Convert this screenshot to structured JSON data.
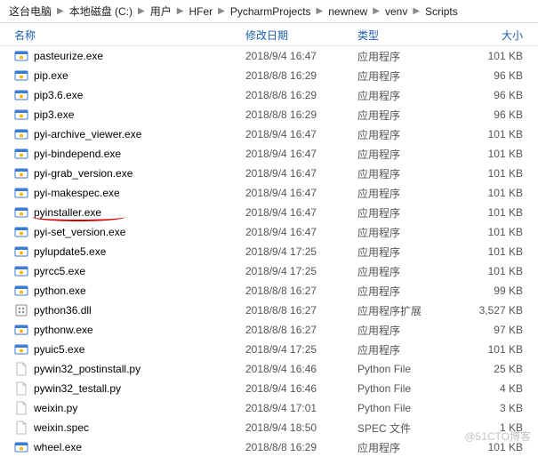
{
  "breadcrumb": {
    "items": [
      "这台电脑",
      "本地磁盘 (C:)",
      "用户",
      "HFer",
      "PycharmProjects",
      "newnew",
      "venv",
      "Scripts"
    ]
  },
  "columns": {
    "name": "名称",
    "date": "修改日期",
    "type": "类型",
    "size": "大小"
  },
  "files": [
    {
      "icon": "exe",
      "name": "pasteurize.exe",
      "date": "2018/9/4 16:47",
      "type": "应用程序",
      "size": "101 KB"
    },
    {
      "icon": "exe",
      "name": "pip.exe",
      "date": "2018/8/8 16:29",
      "type": "应用程序",
      "size": "96 KB"
    },
    {
      "icon": "exe",
      "name": "pip3.6.exe",
      "date": "2018/8/8 16:29",
      "type": "应用程序",
      "size": "96 KB"
    },
    {
      "icon": "exe",
      "name": "pip3.exe",
      "date": "2018/8/8 16:29",
      "type": "应用程序",
      "size": "96 KB"
    },
    {
      "icon": "exe",
      "name": "pyi-archive_viewer.exe",
      "date": "2018/9/4 16:47",
      "type": "应用程序",
      "size": "101 KB"
    },
    {
      "icon": "exe",
      "name": "pyi-bindepend.exe",
      "date": "2018/9/4 16:47",
      "type": "应用程序",
      "size": "101 KB"
    },
    {
      "icon": "exe",
      "name": "pyi-grab_version.exe",
      "date": "2018/9/4 16:47",
      "type": "应用程序",
      "size": "101 KB"
    },
    {
      "icon": "exe",
      "name": "pyi-makespec.exe",
      "date": "2018/9/4 16:47",
      "type": "应用程序",
      "size": "101 KB"
    },
    {
      "icon": "exe",
      "name": "pyinstaller.exe",
      "date": "2018/9/4 16:47",
      "type": "应用程序",
      "size": "101 KB",
      "highlight": true
    },
    {
      "icon": "exe",
      "name": "pyi-set_version.exe",
      "date": "2018/9/4 16:47",
      "type": "应用程序",
      "size": "101 KB"
    },
    {
      "icon": "exe",
      "name": "pylupdate5.exe",
      "date": "2018/9/4 17:25",
      "type": "应用程序",
      "size": "101 KB"
    },
    {
      "icon": "exe",
      "name": "pyrcc5.exe",
      "date": "2018/9/4 17:25",
      "type": "应用程序",
      "size": "101 KB"
    },
    {
      "icon": "exe",
      "name": "python.exe",
      "date": "2018/8/8 16:27",
      "type": "应用程序",
      "size": "99 KB"
    },
    {
      "icon": "dll",
      "name": "python36.dll",
      "date": "2018/8/8 16:27",
      "type": "应用程序扩展",
      "size": "3,527 KB"
    },
    {
      "icon": "exe",
      "name": "pythonw.exe",
      "date": "2018/8/8 16:27",
      "type": "应用程序",
      "size": "97 KB"
    },
    {
      "icon": "exe",
      "name": "pyuic5.exe",
      "date": "2018/9/4 17:25",
      "type": "应用程序",
      "size": "101 KB"
    },
    {
      "icon": "py",
      "name": "pywin32_postinstall.py",
      "date": "2018/9/4 16:46",
      "type": "Python File",
      "size": "25 KB"
    },
    {
      "icon": "py",
      "name": "pywin32_testall.py",
      "date": "2018/9/4 16:46",
      "type": "Python File",
      "size": "4 KB"
    },
    {
      "icon": "py",
      "name": "weixin.py",
      "date": "2018/9/4 17:01",
      "type": "Python File",
      "size": "3 KB"
    },
    {
      "icon": "spec",
      "name": "weixin.spec",
      "date": "2018/9/4 18:50",
      "type": "SPEC 文件",
      "size": "1 KB"
    },
    {
      "icon": "exe",
      "name": "wheel.exe",
      "date": "2018/8/8 16:29",
      "type": "应用程序",
      "size": "101 KB"
    }
  ],
  "icon_labels": {
    "exe": "exe-icon",
    "dll": "dll-icon",
    "py": "python-file-icon",
    "spec": "generic-file-icon"
  },
  "watermark": "@51CTO博客"
}
